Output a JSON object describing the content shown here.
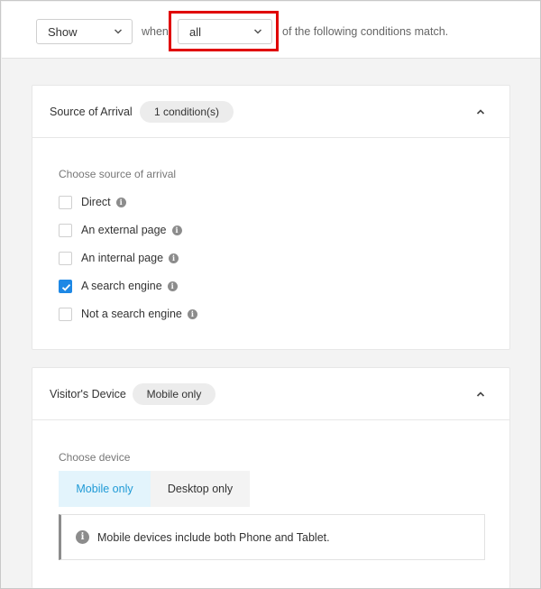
{
  "header": {
    "action_select": "Show",
    "when_text": "when",
    "match_select": "all",
    "tail_text": "of the following conditions match."
  },
  "source_card": {
    "title": "Source of Arrival",
    "badge": "1 condition(s)",
    "section_label": "Choose source of arrival",
    "options": [
      {
        "label": "Direct",
        "checked": false
      },
      {
        "label": "An external page",
        "checked": false
      },
      {
        "label": "An internal page",
        "checked": false
      },
      {
        "label": "A search engine",
        "checked": true
      },
      {
        "label": "Not a search engine",
        "checked": false
      }
    ]
  },
  "device_card": {
    "title": "Visitor's Device",
    "badge": "Mobile only",
    "section_label": "Choose device",
    "segments": [
      {
        "label": "Mobile only",
        "selected": true
      },
      {
        "label": "Desktop only",
        "selected": false
      }
    ],
    "note": "Mobile devices include both Phone and Tablet."
  },
  "icons": {
    "info": "i",
    "chevron": "chevron-down-icon",
    "collapse": "chevron-up-icon"
  },
  "colors": {
    "accent": "#1e88e5",
    "selected_segment_bg": "#e3f4fc",
    "selected_segment_text": "#1f9ad6",
    "highlight": "#e00000"
  }
}
